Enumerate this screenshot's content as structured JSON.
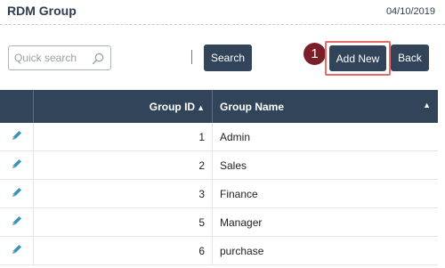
{
  "header": {
    "title": "RDM Group",
    "date": "04/10/2019"
  },
  "toolbar": {
    "search_placeholder": "Quick search",
    "search_label": "Search",
    "add_new_label": "Add New",
    "back_label": "Back",
    "step_number": "1"
  },
  "table": {
    "columns": {
      "group_id": "Group ID",
      "group_name": "Group Name"
    },
    "rows": [
      {
        "id": "1",
        "name": "Admin"
      },
      {
        "id": "2",
        "name": "Sales"
      },
      {
        "id": "3",
        "name": "Finance"
      },
      {
        "id": "5",
        "name": "Manager"
      },
      {
        "id": "6",
        "name": "purchase"
      }
    ]
  },
  "colors": {
    "header_bg": "#31445a",
    "highlight": "#e46c6c",
    "step_badge": "#7a1f2a",
    "edit_icon": "#3a8fc4"
  },
  "icons": {
    "search": "magnifier-icon",
    "edit": "pencil-icon",
    "sort": "sort-icon"
  }
}
